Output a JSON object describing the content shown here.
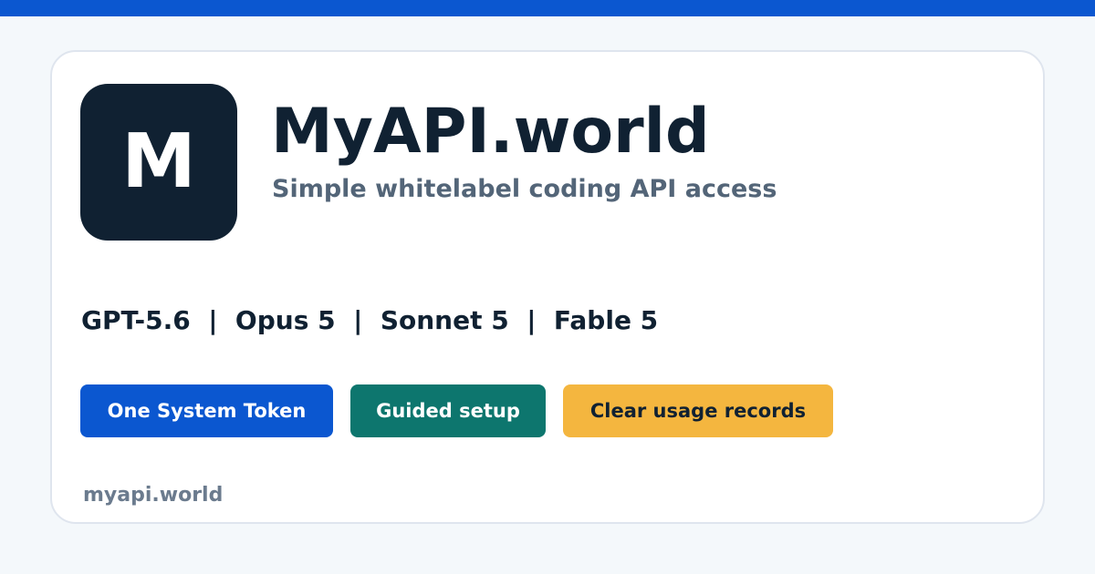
{
  "brand": {
    "logo_letter": "M",
    "title": "MyAPI.world",
    "subtitle": "Simple whitelabel coding API access",
    "domain": "myapi.world"
  },
  "models": {
    "line": "GPT-5.6  |  Opus 5  |  Sonnet 5  |  Fable 5",
    "items": [
      "GPT-5.6",
      "Opus 5",
      "Sonnet 5",
      "Fable 5"
    ]
  },
  "actions": {
    "token_label": "One System Token",
    "setup_label": "Guided setup",
    "clear_label": "Clear usage records"
  },
  "colors": {
    "accent_blue": "#0b57d0",
    "teal": "#0d766e",
    "amber": "#f4b63f",
    "navy": "#102132",
    "muted": "#536578",
    "background": "#f4f8fb"
  }
}
